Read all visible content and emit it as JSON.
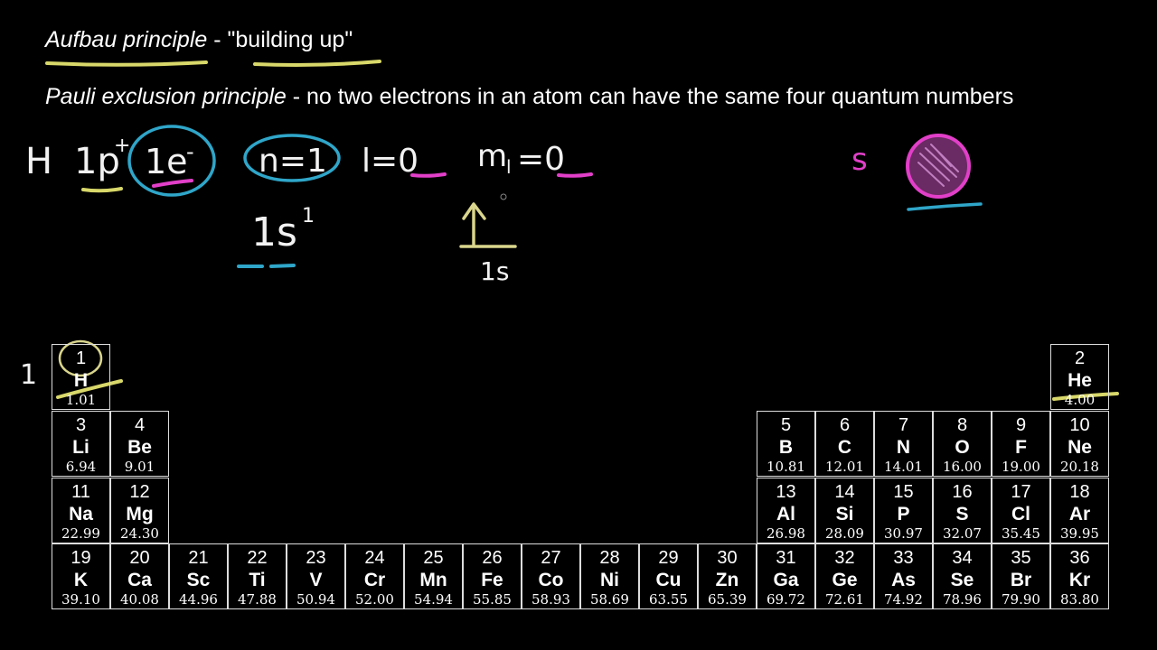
{
  "heading": {
    "aufbau_term": "Aufbau principle",
    "aufbau_rest": " - \"building up\"",
    "pauli_term": "Pauli exclusion principle",
    "pauli_rest": " - no two electrons in an atom can have the same four quantum numbers"
  },
  "handwriting": {
    "element": "H",
    "protons": "1p",
    "protons_sup": "+",
    "electrons": "1e",
    "electrons_sup": "-",
    "n": "n=1",
    "l": "l=0",
    "ml": "m",
    "ml_sub": "l",
    "ml_val": "=0",
    "config": "1s",
    "config_sup": "1",
    "orbital_label": "1s",
    "s_label": "s",
    "period_label": "1"
  },
  "colors": {
    "ink_white": "#f2f2f2",
    "highlight_yellow": "#d8d86a",
    "teal": "#2fa6c9",
    "magenta": "#e23fc9",
    "arrow_yellow": "#d9d58c"
  },
  "periodic_table": {
    "elements": [
      {
        "n": "1",
        "s": "H",
        "m": "1.01"
      },
      {
        "n": "2",
        "s": "He",
        "m": "4.00"
      },
      {
        "n": "3",
        "s": "Li",
        "m": "6.94"
      },
      {
        "n": "4",
        "s": "Be",
        "m": "9.01"
      },
      {
        "n": "5",
        "s": "B",
        "m": "10.81"
      },
      {
        "n": "6",
        "s": "C",
        "m": "12.01"
      },
      {
        "n": "7",
        "s": "N",
        "m": "14.01"
      },
      {
        "n": "8",
        "s": "O",
        "m": "16.00"
      },
      {
        "n": "9",
        "s": "F",
        "m": "19.00"
      },
      {
        "n": "10",
        "s": "Ne",
        "m": "20.18"
      },
      {
        "n": "11",
        "s": "Na",
        "m": "22.99"
      },
      {
        "n": "12",
        "s": "Mg",
        "m": "24.30"
      },
      {
        "n": "13",
        "s": "Al",
        "m": "26.98"
      },
      {
        "n": "14",
        "s": "Si",
        "m": "28.09"
      },
      {
        "n": "15",
        "s": "P",
        "m": "30.97"
      },
      {
        "n": "16",
        "s": "S",
        "m": "32.07"
      },
      {
        "n": "17",
        "s": "Cl",
        "m": "35.45"
      },
      {
        "n": "18",
        "s": "Ar",
        "m": "39.95"
      },
      {
        "n": "19",
        "s": "K",
        "m": "39.10"
      },
      {
        "n": "20",
        "s": "Ca",
        "m": "40.08"
      },
      {
        "n": "21",
        "s": "Sc",
        "m": "44.96"
      },
      {
        "n": "22",
        "s": "Ti",
        "m": "47.88"
      },
      {
        "n": "23",
        "s": "V",
        "m": "50.94"
      },
      {
        "n": "24",
        "s": "Cr",
        "m": "52.00"
      },
      {
        "n": "25",
        "s": "Mn",
        "m": "54.94"
      },
      {
        "n": "26",
        "s": "Fe",
        "m": "55.85"
      },
      {
        "n": "27",
        "s": "Co",
        "m": "58.93"
      },
      {
        "n": "28",
        "s": "Ni",
        "m": "58.69"
      },
      {
        "n": "29",
        "s": "Cu",
        "m": "63.55"
      },
      {
        "n": "30",
        "s": "Zn",
        "m": "65.39"
      },
      {
        "n": "31",
        "s": "Ga",
        "m": "69.72"
      },
      {
        "n": "32",
        "s": "Ge",
        "m": "72.61"
      },
      {
        "n": "33",
        "s": "As",
        "m": "74.92"
      },
      {
        "n": "34",
        "s": "Se",
        "m": "78.96"
      },
      {
        "n": "35",
        "s": "Br",
        "m": "79.90"
      },
      {
        "n": "36",
        "s": "Kr",
        "m": "83.80"
      }
    ]
  }
}
